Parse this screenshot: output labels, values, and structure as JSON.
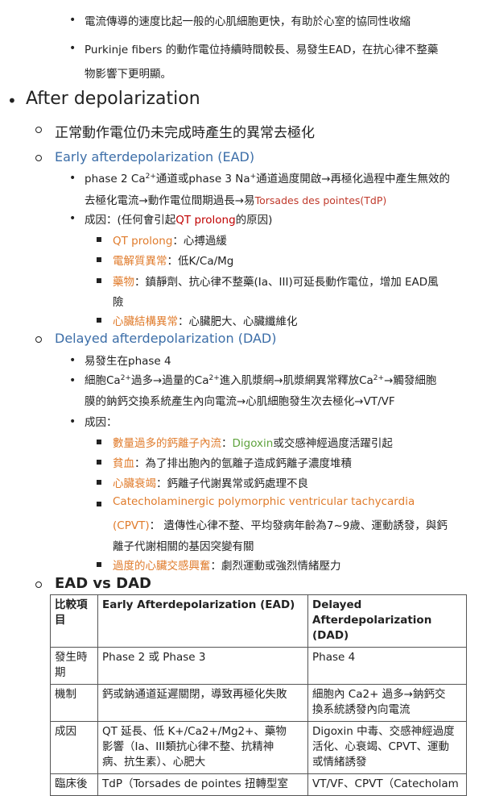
{
  "top_bullets": [
    {
      "text": "電流傳導的速度比起一般的心肌細胞更快，有助於心室的協同性收縮"
    },
    {
      "line1": "Purkinje fibers 的動作電位持續時間較長、易發生EAD，在抗心律不整藥",
      "line2": "物影響下更明顯。"
    }
  ],
  "section_title": "After depolarization",
  "intro": "正常動作電位仍未完成時產生的異常去極化",
  "ead": {
    "title": "Early afterdepolarization (EAD)",
    "mech_a": "phase 2 Ca",
    "mech_sup1": "2+",
    "mech_b": "通道或phase 3 Na",
    "mech_sup2": "+",
    "mech_c": "通道過度開啟→再極化過程中產生無效的",
    "mech_line2": "去極化電流→動作電位間期過長→易",
    "mech_tdp": "Torsades des pointes(TdP)",
    "cause_a": "成因：(任何會引起",
    "cause_qt": "QT prolong",
    "cause_b": "的原因)",
    "causes": [
      {
        "label": "QT prolong",
        "desc": "：心搏過緩"
      },
      {
        "label": "電解質異常",
        "desc": "：低K/Ca/Mg"
      },
      {
        "label": "藥物",
        "desc": "：鎮靜劑、抗心律不整藥(Ia、III)可延長動作電位，增加 EAD風",
        "desc2": "險"
      },
      {
        "label": "心臟結構異常",
        "desc": "：心臟肥大、心臟纖維化"
      }
    ]
  },
  "dad": {
    "title": "Delayed afterdepolarization (DAD)",
    "phase": "易發生在phase 4",
    "m_a": "細胞Ca",
    "m_s1": "2+",
    "m_b": "過多→過量的Ca",
    "m_s2": "2+",
    "m_c": "進入肌漿網→肌漿網異常釋放Ca",
    "m_s3": "2+",
    "m_d": "→觸發細胞",
    "m_line2": "膜的鈉鈣交換系統產生內向電流→心肌細胞發生次去極化→VT/VF",
    "cause": "成因：",
    "c1_label": "數量過多的鈣離子內流",
    "c1_sep": "：",
    "c1_green": "Digoxin",
    "c1_rest": "或交感神經過度活躍引起",
    "c2_label": "貧血",
    "c2_desc": "：為了排出胞內的氫離子造成鈣離子濃度堆積",
    "c3_label": "心臟衰竭",
    "c3_desc": "：鈣離子代謝異常或鈣處理不良",
    "c4_label": "Catecholaminergic polymorphic ventricular tachycardia",
    "c4_label2": "(CPVT)",
    "c4_desc": "： 遺傳性心律不整、平均發病年齡為7~9歲、運動誘發，與鈣",
    "c4_desc2": "離子代謝相關的基因突變有關",
    "c5_label": "過度的心臟交感興奮",
    "c5_desc": "：劇烈運動或強烈情緒壓力"
  },
  "compare_title": "EAD vs DAD",
  "table": {
    "h0a": "比較項",
    "h0b": "目",
    "h1": "Early Afterdepolarization (EAD)",
    "h2a": "Delayed",
    "h2b": "Afterdepolarization (DAD)",
    "r1": {
      "c0a": "發生時",
      "c0b": "期",
      "c1": "Phase 2 或 Phase 3",
      "c2": "Phase 4"
    },
    "r2": {
      "c0": "機制",
      "c1": "鈣或鈉通道延遲關閉，導致再極化失敗",
      "c2a": "細胞內 Ca2+ 過多→鈉鈣交",
      "c2b": "換系統誘發內向電流"
    },
    "r3": {
      "c0": "成因",
      "c1a": "QT 延長、低 K+/Ca2+/Mg2+、藥物",
      "c1b": "影響（Ia、III類抗心律不整、抗精神",
      "c1c": "病、抗生素）、心肥大",
      "c2a": "Digoxin 中毒、交感神經過度",
      "c2b": "活化、心衰竭、CPVT、運動",
      "c2c": "或情緒誘發"
    },
    "r4": {
      "c0": "臨床後",
      "c1": "TdP（Torsades de pointes 扭轉型室",
      "c2": "VT/VF、CPVT（Catecholam"
    }
  }
}
